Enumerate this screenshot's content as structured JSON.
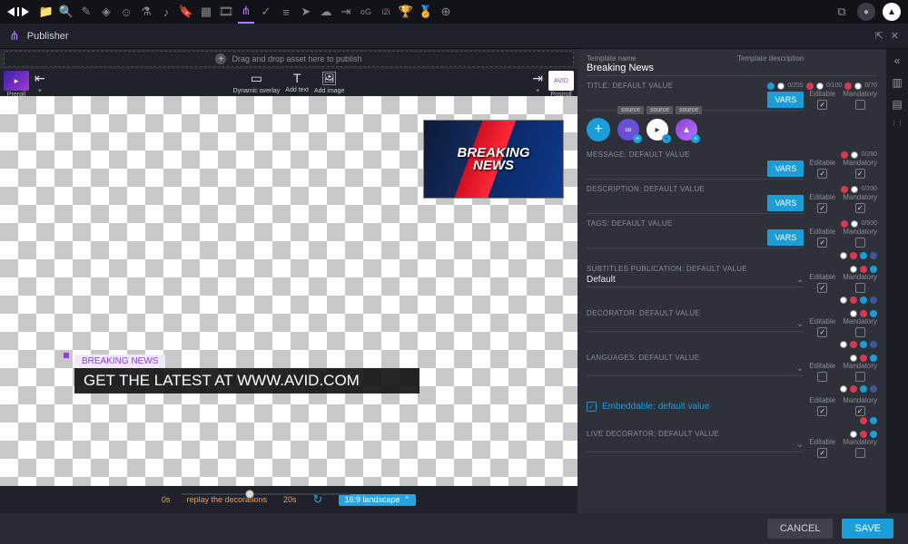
{
  "app": {
    "name": "Avid",
    "panel": "Publisher"
  },
  "topbar_icons": [
    "folder",
    "search",
    "edit",
    "diamond",
    "user",
    "flask",
    "note",
    "bookmark",
    "grid",
    "film",
    "share",
    "check",
    "list",
    "send",
    "cloud",
    "clip",
    "og",
    "i2i",
    "trophy",
    "award",
    "zoom"
  ],
  "dropzone": "Drag and drop asset here to publish",
  "tools": {
    "preroll": "Preroll",
    "postroll": "Postroll",
    "dynamic_overlay": "Dynamic overlay",
    "add_text": "Add text",
    "add_image": "Add image"
  },
  "template": {
    "name_label": "Template name",
    "name_value": "Breaking News",
    "desc_label": "Template description",
    "desc_value": ""
  },
  "canvas": {
    "thumb_line1": "BREAKING",
    "thumb_line2": "NEWS",
    "lower_tag": "BREAKING NEWS",
    "lower_text": "GET THE LATEST AT WWW.AVID.COM"
  },
  "timeline": {
    "start": "0s",
    "mid": "replay the decorations",
    "end": "20s",
    "aspect": "16:9 landscape"
  },
  "fields": [
    {
      "key": "title",
      "label": "TITLE: DEFAULT VALUE",
      "value": "<empty>",
      "vars": true,
      "counters": [
        "0/255",
        "0/100",
        "0/70"
      ],
      "editable": true,
      "mandatory": false
    },
    {
      "key": "message",
      "label": "MESSAGE: DEFAULT VALUE",
      "value": "<empty>",
      "vars": true,
      "counters": [
        "0/280"
      ],
      "editable": true,
      "mandatory": true
    },
    {
      "key": "description",
      "label": "DESCRIPTION: DEFAULT VALUE",
      "value": "<empty>",
      "vars": true,
      "counters": [
        "0/200"
      ],
      "editable": true,
      "mandatory": true
    },
    {
      "key": "tags",
      "label": "TAGS: DEFAULT VALUE",
      "value": "",
      "vars": true,
      "counters": [
        "0/500"
      ],
      "editable": true,
      "mandatory": false
    },
    {
      "key": "subtitles",
      "label": "SUBTITLES PUBLICATION: DEFAULT VALUE",
      "value": "Default",
      "dropdown": true,
      "editable": true,
      "mandatory": false
    },
    {
      "key": "decorator",
      "label": "DECORATOR: DEFAULT VALUE",
      "value": "",
      "dropdown": true,
      "editable": true,
      "mandatory": false
    },
    {
      "key": "languages",
      "label": "LANGUAGES: DEFAULT VALUE",
      "value": "",
      "dropdown": true,
      "editable": false,
      "mandatory": false
    },
    {
      "key": "livedeco",
      "label": "LIVE DECORATOR: DEFAULT VALUE",
      "value": "",
      "dropdown": true,
      "editable": true,
      "mandatory": false
    }
  ],
  "labels": {
    "vars": "VARS",
    "editable": "Editable",
    "mandatory": "Mandatory",
    "source": "source",
    "empty": "<empty>"
  },
  "embeddable": {
    "label": "Embeddable: default value",
    "checked": true,
    "editable": true,
    "mandatory": true
  },
  "footer": {
    "cancel": "CANCEL",
    "save": "SAVE"
  }
}
